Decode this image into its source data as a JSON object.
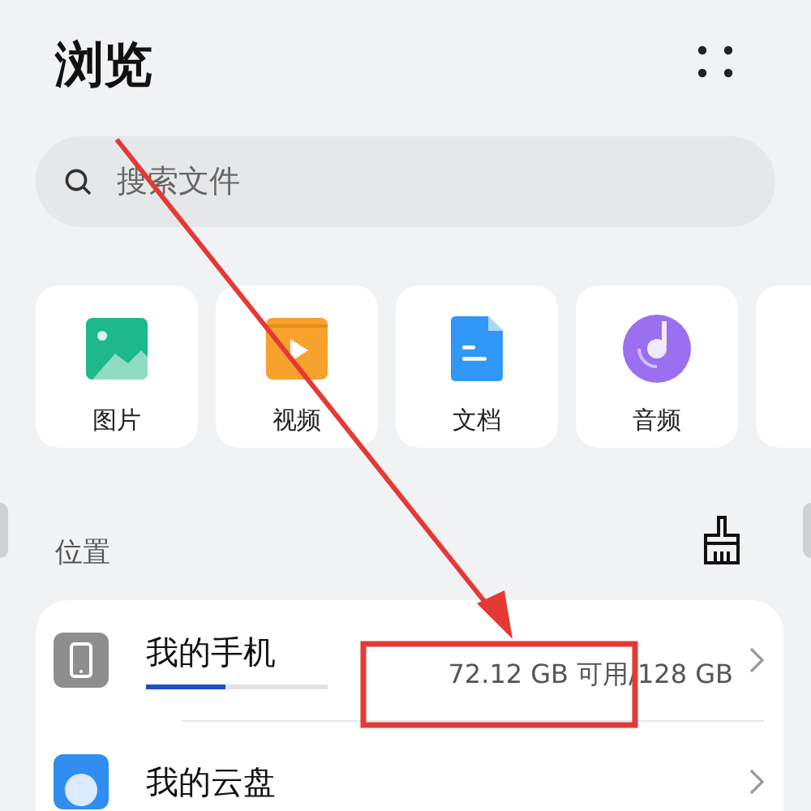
{
  "title": "浏览",
  "search": {
    "placeholder": "搜索文件"
  },
  "categories": [
    {
      "kind": "image",
      "label": "图片"
    },
    {
      "kind": "video",
      "label": "视频"
    },
    {
      "kind": "document",
      "label": "文档"
    },
    {
      "kind": "audio",
      "label": "音频"
    }
  ],
  "locations_section": {
    "label": "位置"
  },
  "locations": [
    {
      "kind": "phone",
      "name": "我的手机",
      "level": 0.44,
      "storage": "72.12 GB 可用/128 GB"
    },
    {
      "kind": "cloud",
      "name": "我的云盘"
    }
  ]
}
